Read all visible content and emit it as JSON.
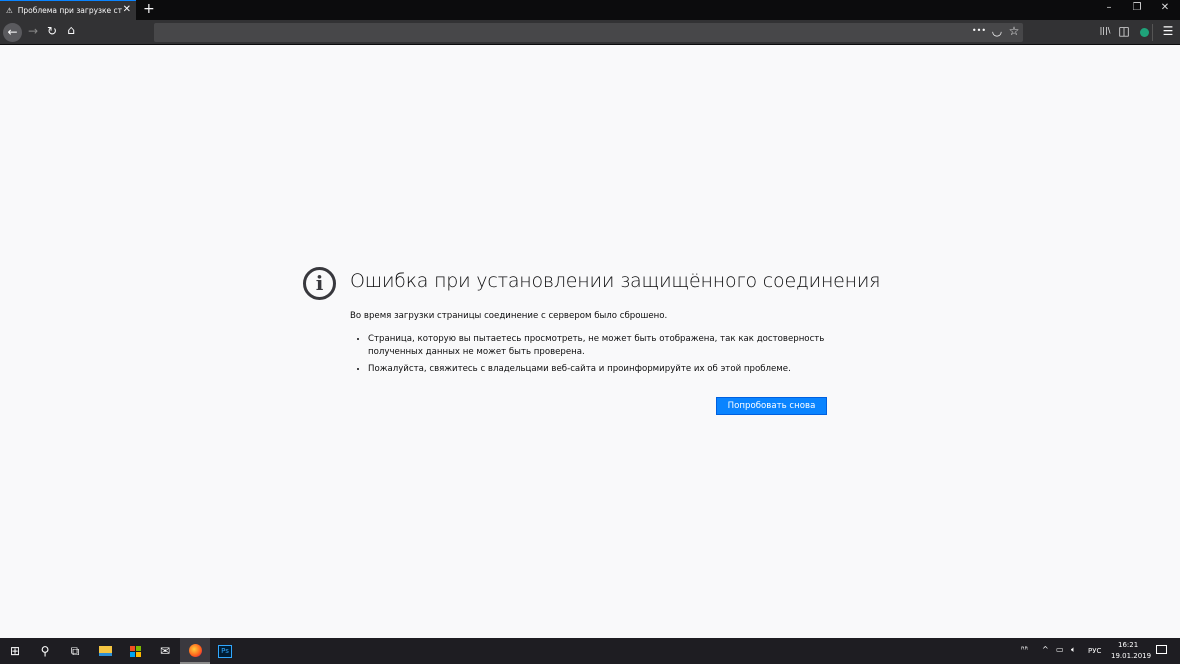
{
  "browser": {
    "tab_title": "Проблема при загрузке страницы",
    "new_tab": "+",
    "window_controls": {
      "minimize": "–",
      "restore": "❐",
      "close": "✕"
    }
  },
  "toolbar": {
    "back": "←",
    "forward": "→",
    "reload": "↻",
    "home": "⌂",
    "page_actions": "•••",
    "pocket": "◡",
    "bookmark": "☆",
    "library": "|||\\",
    "sidebar": "◫",
    "menu": "☰"
  },
  "error": {
    "title": "Ошибка при установлении защищённого соединения",
    "description": "Во время загрузки страницы соединение с сервером было сброшено.",
    "bullets": [
      "Страница, которую вы пытаетесь просмотреть, не может быть отображена, так как достоверность полученных данных не может быть проверена.",
      "Пожалуйста, свяжитесь с владельцами веб-сайта и проинформируйте их об этой проблеме."
    ],
    "retry_label": "Попробовать снова"
  },
  "taskbar": {
    "ps_label": "Ps",
    "language": "РУС",
    "time": "16:21",
    "date": "19.01.2019"
  }
}
